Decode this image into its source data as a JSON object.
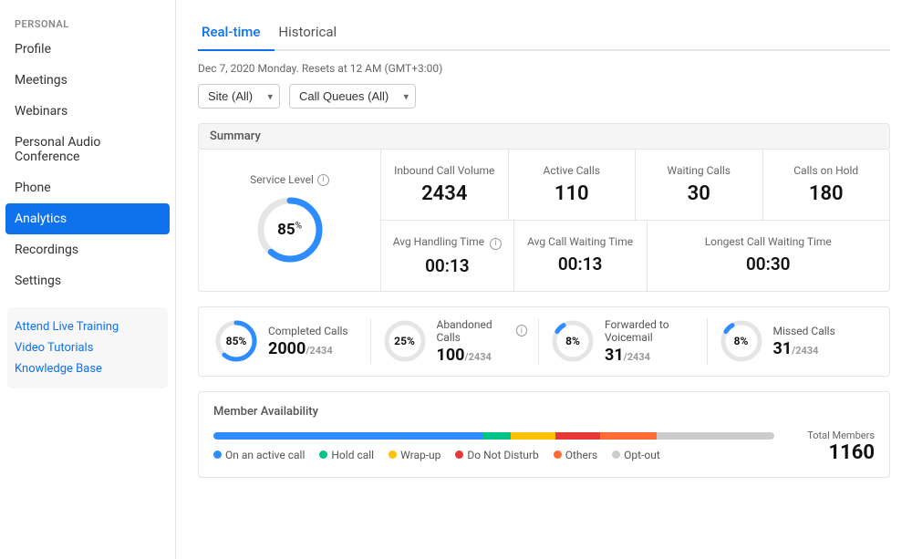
{
  "sidebar": {
    "section_label": "PERSONAL",
    "items": [
      {
        "label": "Profile",
        "active": false
      },
      {
        "label": "Meetings",
        "active": false
      },
      {
        "label": "Webinars",
        "active": false
      },
      {
        "label": "Personal Audio Conference",
        "active": false
      },
      {
        "label": "Phone",
        "active": false
      },
      {
        "label": "Analytics",
        "active": true
      },
      {
        "label": "Recordings",
        "active": false
      },
      {
        "label": "Settings",
        "active": false
      }
    ],
    "resources": {
      "links": [
        {
          "label": "Attend Live Training"
        },
        {
          "label": "Video Tutorials"
        },
        {
          "label": "Knowledge Base"
        }
      ]
    }
  },
  "tabs": [
    {
      "label": "Real-time",
      "active": true
    },
    {
      "label": "Historical",
      "active": false
    }
  ],
  "date_info": "Dec 7, 2020 Monday. Resets at 12 AM (GMT+3:00)",
  "filters": [
    {
      "label": "Site (All)",
      "value": "site-all"
    },
    {
      "label": "Call Queues (All)",
      "value": "queues-all"
    }
  ],
  "summary_label": "Summary",
  "service_level": {
    "label": "Service Level",
    "value": "85",
    "suffix": "%"
  },
  "top_stats": [
    {
      "label": "Inbound Call Volume",
      "value": "2434"
    },
    {
      "label": "Active Calls",
      "value": "110"
    },
    {
      "label": "Waiting Calls",
      "value": "30"
    },
    {
      "label": "Calls on Hold",
      "value": "180"
    }
  ],
  "time_stats": [
    {
      "label": "Avg Handling Time",
      "value": "00:13",
      "has_info": true
    },
    {
      "label": "Avg Call Waiting Time",
      "value": "00:13",
      "has_info": false
    },
    {
      "label": "Longest Call Waiting Time",
      "value": "00:30",
      "has_info": false
    }
  ],
  "call_stats": [
    {
      "label": "Completed Calls",
      "pct": 85,
      "main": "2000",
      "sub": "/2434",
      "has_info": false
    },
    {
      "label": "Abandoned Calls",
      "pct": 25,
      "main": "100",
      "sub": "/2434",
      "has_info": true
    },
    {
      "label": "Forwarded to Voicemail",
      "pct": 8,
      "main": "31",
      "sub": "/2434",
      "has_info": false
    },
    {
      "label": "Missed Calls",
      "pct": 8,
      "main": "31",
      "sub": "/2434",
      "has_info": false
    }
  ],
  "member_availability": {
    "title": "Member Availability",
    "total_members_label": "Total Members",
    "total_members_value": "1160",
    "bars": [
      {
        "color": "#2d8cff",
        "pct": 48
      },
      {
        "color": "#00c38c",
        "pct": 5
      },
      {
        "color": "#ffc107",
        "pct": 8
      },
      {
        "color": "#e53935",
        "pct": 8
      },
      {
        "color": "#ff6b35",
        "pct": 10
      },
      {
        "color": "#ccc",
        "pct": 21
      }
    ],
    "legend": [
      {
        "label": "On an active call",
        "color": "#2d8cff"
      },
      {
        "label": "Hold call",
        "color": "#00c38c"
      },
      {
        "label": "Wrap-up",
        "color": "#ffc107"
      },
      {
        "label": "Do Not Disturb",
        "color": "#e53935"
      },
      {
        "label": "Others",
        "color": "#ff6b35"
      },
      {
        "label": "Opt-out",
        "color": "#ccc"
      }
    ]
  }
}
